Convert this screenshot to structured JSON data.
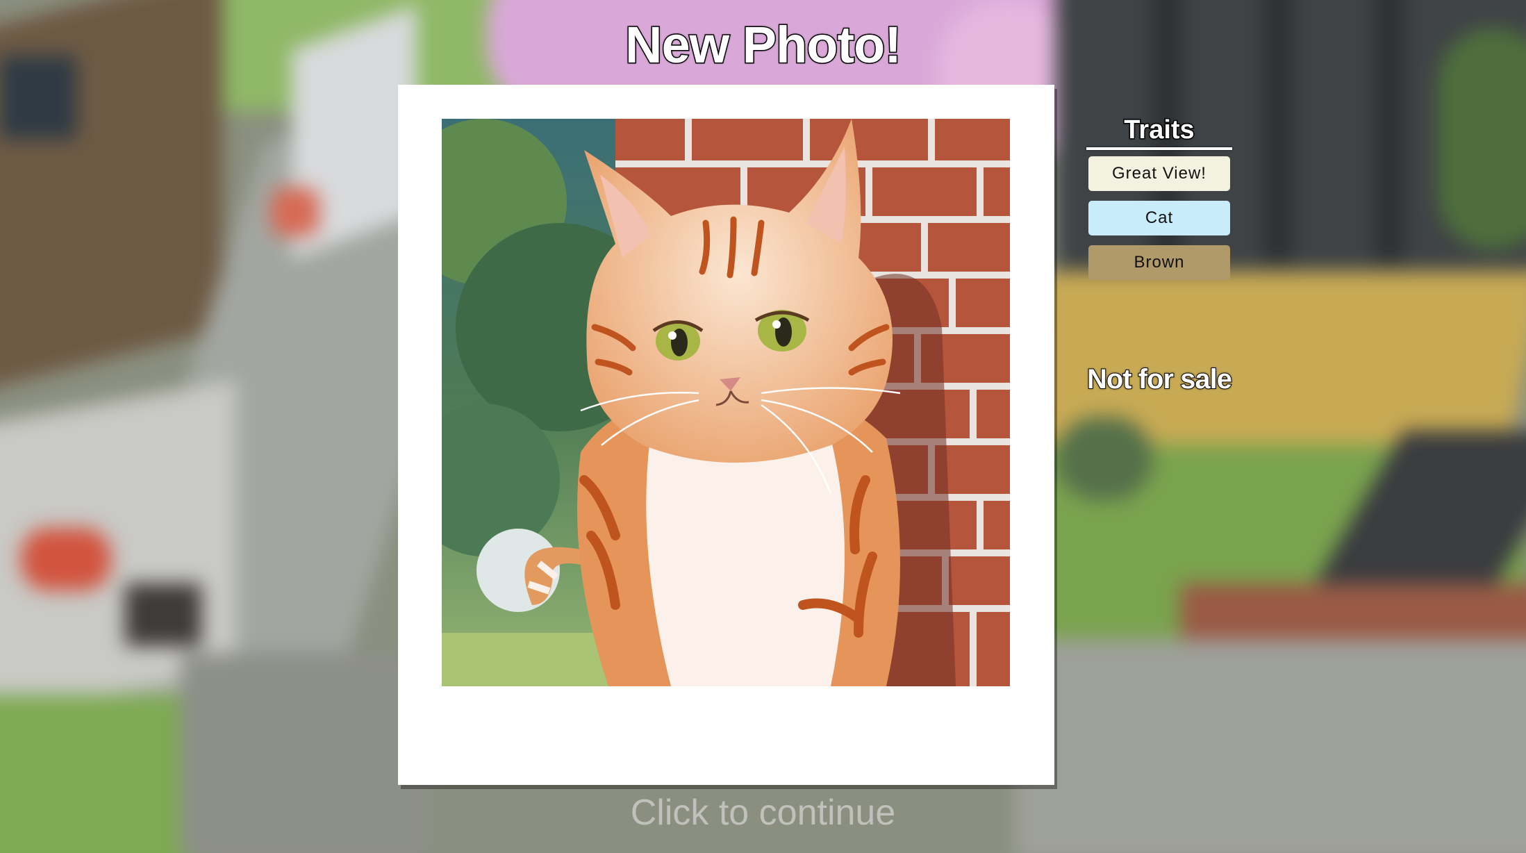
{
  "screen": {
    "title": "New Photo!",
    "continue_hint": "Click to continue"
  },
  "photo": {
    "subject_icon": "tabby-cat-portrait",
    "palette": {
      "fur": "#e6955a",
      "stripes": "#c0541e",
      "chest": "#fbf1ea",
      "brick": "#b5553b",
      "foliage": "#4f7a4d",
      "eyes": "#a7b645"
    }
  },
  "traits": {
    "heading": "Traits",
    "items": [
      {
        "label": "Great View!",
        "color": "#f3f1df"
      },
      {
        "label": "Cat",
        "color": "#c9ecfb"
      },
      {
        "label": "Brown",
        "color": "#b19a69"
      }
    ]
  },
  "sale_status": "Not for sale"
}
